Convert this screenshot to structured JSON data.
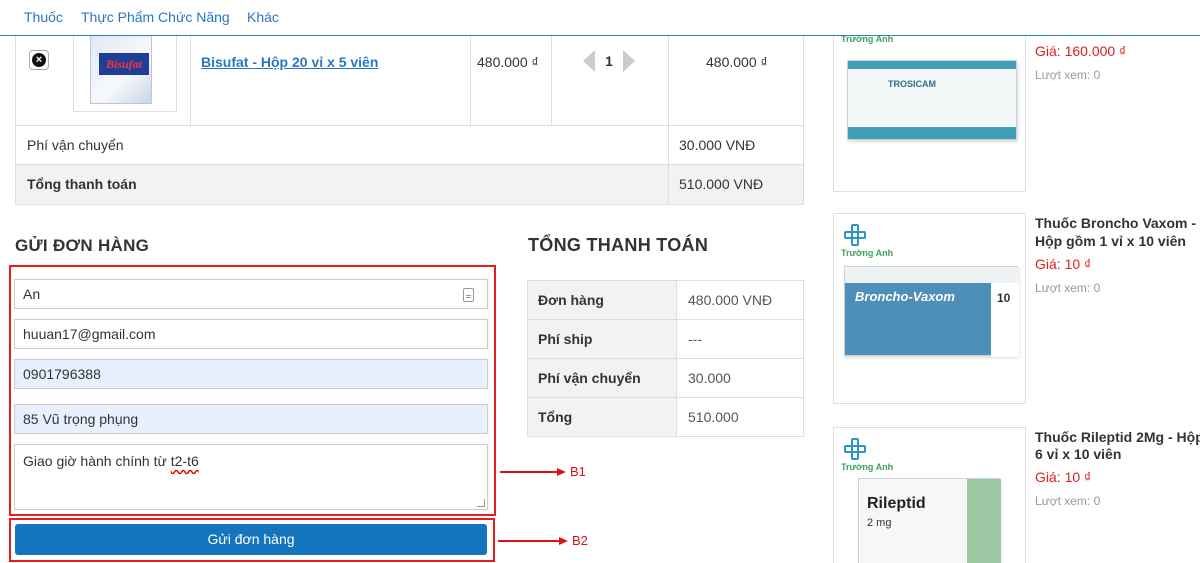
{
  "nav": {
    "items": [
      "Thuốc",
      "Thực Phẩm Chức Năng",
      "Khác"
    ]
  },
  "cart": {
    "item": {
      "product_image_text": "Bisufat",
      "name": "Bisufat - Hộp 20 vỉ x 5 viên",
      "unit_price": "480.000 ₫",
      "quantity": "1",
      "line_total": "480.000 ₫"
    },
    "shipping_label": "Phí vận chuyển",
    "shipping_value": "30.000 VNĐ",
    "total_label": "Tổng thanh toán",
    "total_value": "510.000 VNĐ"
  },
  "order_form": {
    "heading": "GỬI ĐƠN HÀNG",
    "name_value": "An",
    "email_value": "huuan17@gmail.com",
    "phone_value": "0901796388",
    "address_value": "85 Vũ trọng phụng",
    "note_prefix": "Giao giờ hành chính từ ",
    "note_flagged": "t2-t6",
    "submit_label": "Gửi đơn hàng"
  },
  "annotations": {
    "b1": "B1",
    "b2": "B2",
    "color": "#d81414"
  },
  "summary": {
    "heading": "TỔNG THANH TOÁN",
    "rows": [
      {
        "label": "Đơn hàng",
        "value": "480.000 VNĐ"
      },
      {
        "label": "Phí ship",
        "value": "---"
      },
      {
        "label": "Phí vận chuyển",
        "value": "30.000"
      },
      {
        "label": "Tổng",
        "value": "510.000"
      }
    ]
  },
  "sidebar": {
    "brand": "Trường Anh",
    "products": [
      {
        "title_lines": [],
        "price": "Giá: 160.000 ₫",
        "views": "Lượt xem: 0",
        "package_text": "TROSICAM"
      },
      {
        "title_lines": [
          "Thuốc Broncho Vaxom -",
          "Hộp gồm 1 vỉ x 10 viên"
        ],
        "price": "Giá: 10 ₫",
        "views": "Lượt xem: 0",
        "package_text": "Broncho-Vaxom",
        "package_number": "10"
      },
      {
        "title_lines": [
          "Thuốc Rileptid 2Mg -  Hộp",
          "6 vỉ x 10 viên"
        ],
        "price": "Giá: 10 ₫",
        "views": "Lượt xem: 0",
        "package_text": "Rileptid",
        "package_sub": "2 mg"
      }
    ]
  },
  "colors": {
    "link": "#2a76c6",
    "button": "#1474be",
    "price": "#e02020",
    "highlight_field": "#e8f0fe"
  }
}
